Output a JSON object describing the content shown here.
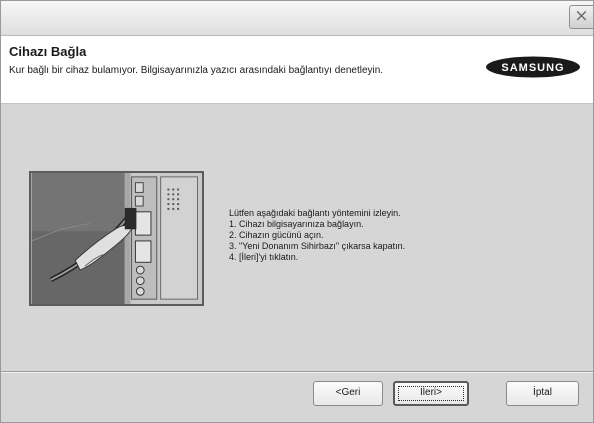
{
  "window": {
    "close_glyph": "×"
  },
  "header": {
    "title": "Cihazı Bağla",
    "subtitle": "Kur bağlı bir cihaz bulamıyor. Bilgisayarınızla yazıcı arasındaki bağlantıyı denetleyin.",
    "logo_text": "SAMSUNG"
  },
  "instructions": {
    "intro": "Lütfen aşağıdaki bağlantı yöntemini izleyin.",
    "steps": [
      "1. Cihazı bilgisayarınıza bağlayın.",
      "2. Cihazın gücünü açın.",
      "3. \"Yeni Donanım Sihirbazı\" çıkarsa kapatın.",
      "4. [İleri]'yi tıklatın."
    ]
  },
  "buttons": {
    "back": "<Geri",
    "next": "İleri>",
    "cancel": "İptal"
  },
  "colors": {
    "dialog_background": "#d6d6d6",
    "header_background": "#ffffff",
    "logo_oval": "#1a1a1a"
  }
}
